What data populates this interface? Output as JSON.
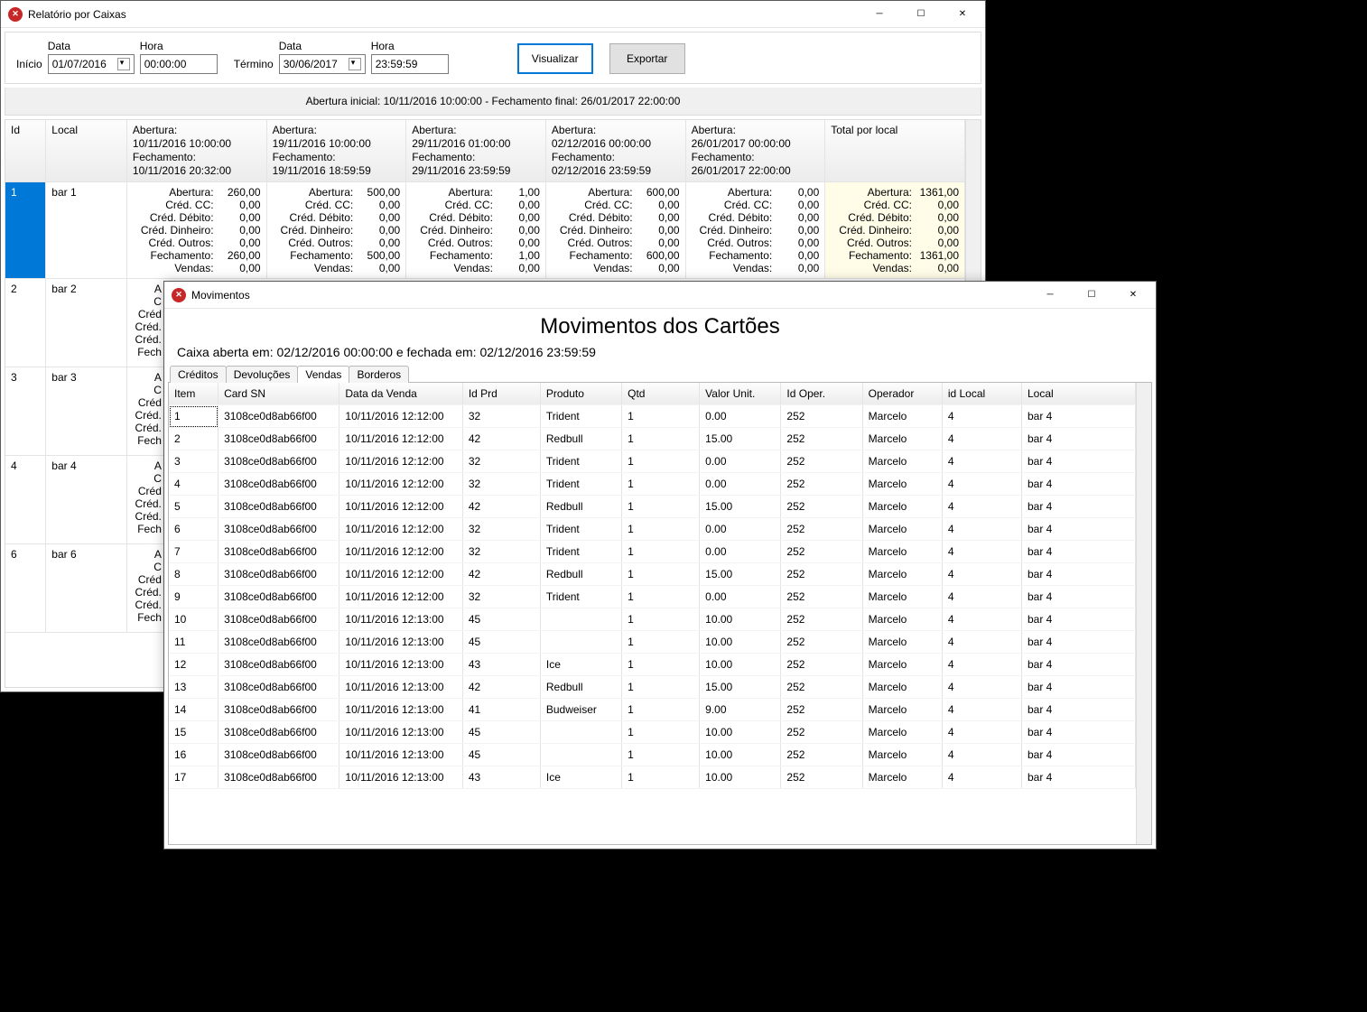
{
  "main": {
    "title": "Relatório por Caixas",
    "toolbar": {
      "inicio_label": "Início",
      "termino_label": "Término",
      "data_label": "Data",
      "hora_label": "Hora",
      "inicio_data": "01/07/2016",
      "inicio_hora": "00:00:00",
      "termino_data": "30/06/2017",
      "termino_hora": "23:59:59",
      "visualizar": "Visualizar",
      "exportar": "Exportar"
    },
    "summary": "Abertura inicial: 10/11/2016 10:00:00 - Fechamento final:  26/01/2017 22:00:00",
    "headers": {
      "id": "Id",
      "local": "Local",
      "total": "Total por local"
    },
    "period_headers": [
      "Abertura:\n10/11/2016 10:00:00\nFechamento:\n10/11/2016 20:32:00",
      "Abertura:\n19/11/2016 10:00:00\nFechamento:\n19/11/2016 18:59:59",
      "Abertura:\n29/11/2016 01:00:00\nFechamento:\n29/11/2016 23:59:59",
      "Abertura:\n02/12/2016 00:00:00\nFechamento:\n02/12/2016 23:59:59",
      "Abertura:\n26/01/2017 00:00:00\nFechamento:\n26/01/2017 22:00:00"
    ],
    "kv_labels": [
      "Abertura:",
      "Créd. CC:",
      "Créd. Débito:",
      "Créd. Dinheiro:",
      "Créd. Outros:",
      "Fechamento:",
      "Vendas:"
    ],
    "rows": [
      {
        "id": "1",
        "local": "bar 1",
        "selected": true,
        "periods": [
          [
            "260,00",
            "0,00",
            "0,00",
            "0,00",
            "0,00",
            "260,00",
            "0,00"
          ],
          [
            "500,00",
            "0,00",
            "0,00",
            "0,00",
            "0,00",
            "500,00",
            "0,00"
          ],
          [
            "1,00",
            "0,00",
            "0,00",
            "0,00",
            "0,00",
            "1,00",
            "0,00"
          ],
          [
            "600,00",
            "0,00",
            "0,00",
            "0,00",
            "0,00",
            "600,00",
            "0,00"
          ],
          [
            "0,00",
            "0,00",
            "0,00",
            "0,00",
            "0,00",
            "0,00",
            "0,00"
          ]
        ],
        "total": [
          "1361,00",
          "0,00",
          "0,00",
          "0,00",
          "0,00",
          "1361,00",
          "0,00"
        ]
      },
      {
        "id": "2",
        "local": "bar 2"
      },
      {
        "id": "3",
        "local": "bar 3"
      },
      {
        "id": "4",
        "local": "bar 4"
      },
      {
        "id": "6",
        "local": "bar 6"
      }
    ],
    "truncated_labels": [
      "A",
      "C",
      "Créd",
      "Créd.",
      "Créd.",
      "Fech"
    ]
  },
  "mov": {
    "title": "Movimentos",
    "big_title": "Movimentos dos Cartões",
    "subtitle": "Caixa aberta em: 02/12/2016 00:00:00 e fechada em: 02/12/2016 23:59:59",
    "tabs": [
      "Créditos",
      "Devoluções",
      "Vendas",
      "Borderos"
    ],
    "active_tab": 2,
    "columns": [
      "Item",
      "Card SN",
      "Data da Venda",
      "Id Prd",
      "Produto",
      "Qtd",
      "Valor Unit.",
      "Id Oper.",
      "Operador",
      "id Local",
      "Local"
    ],
    "rows": [
      [
        "1",
        "3108ce0d8ab66f00",
        "10/11/2016 12:12:00",
        "32",
        "Trident",
        "1",
        "0.00",
        "252",
        "Marcelo",
        "4",
        "bar 4"
      ],
      [
        "2",
        "3108ce0d8ab66f00",
        "10/11/2016 12:12:00",
        "42",
        "Redbull",
        "1",
        "15.00",
        "252",
        "Marcelo",
        "4",
        "bar 4"
      ],
      [
        "3",
        "3108ce0d8ab66f00",
        "10/11/2016 12:12:00",
        "32",
        "Trident",
        "1",
        "0.00",
        "252",
        "Marcelo",
        "4",
        "bar 4"
      ],
      [
        "4",
        "3108ce0d8ab66f00",
        "10/11/2016 12:12:00",
        "32",
        "Trident",
        "1",
        "0.00",
        "252",
        "Marcelo",
        "4",
        "bar 4"
      ],
      [
        "5",
        "3108ce0d8ab66f00",
        "10/11/2016 12:12:00",
        "42",
        "Redbull",
        "1",
        "15.00",
        "252",
        "Marcelo",
        "4",
        "bar 4"
      ],
      [
        "6",
        "3108ce0d8ab66f00",
        "10/11/2016 12:12:00",
        "32",
        "Trident",
        "1",
        "0.00",
        "252",
        "Marcelo",
        "4",
        "bar 4"
      ],
      [
        "7",
        "3108ce0d8ab66f00",
        "10/11/2016 12:12:00",
        "32",
        "Trident",
        "1",
        "0.00",
        "252",
        "Marcelo",
        "4",
        "bar 4"
      ],
      [
        "8",
        "3108ce0d8ab66f00",
        "10/11/2016 12:12:00",
        "42",
        "Redbull",
        "1",
        "15.00",
        "252",
        "Marcelo",
        "4",
        "bar 4"
      ],
      [
        "9",
        "3108ce0d8ab66f00",
        "10/11/2016 12:12:00",
        "32",
        "Trident",
        "1",
        "0.00",
        "252",
        "Marcelo",
        "4",
        "bar 4"
      ],
      [
        "10",
        "3108ce0d8ab66f00",
        "10/11/2016 12:13:00",
        "45",
        "",
        "1",
        "10.00",
        "252",
        "Marcelo",
        "4",
        "bar 4"
      ],
      [
        "11",
        "3108ce0d8ab66f00",
        "10/11/2016 12:13:00",
        "45",
        "",
        "1",
        "10.00",
        "252",
        "Marcelo",
        "4",
        "bar 4"
      ],
      [
        "12",
        "3108ce0d8ab66f00",
        "10/11/2016 12:13:00",
        "43",
        "Ice",
        "1",
        "10.00",
        "252",
        "Marcelo",
        "4",
        "bar 4"
      ],
      [
        "13",
        "3108ce0d8ab66f00",
        "10/11/2016 12:13:00",
        "42",
        "Redbull",
        "1",
        "15.00",
        "252",
        "Marcelo",
        "4",
        "bar 4"
      ],
      [
        "14",
        "3108ce0d8ab66f00",
        "10/11/2016 12:13:00",
        "41",
        "Budweiser",
        "1",
        "9.00",
        "252",
        "Marcelo",
        "4",
        "bar 4"
      ],
      [
        "15",
        "3108ce0d8ab66f00",
        "10/11/2016 12:13:00",
        "45",
        "",
        "1",
        "10.00",
        "252",
        "Marcelo",
        "4",
        "bar 4"
      ],
      [
        "16",
        "3108ce0d8ab66f00",
        "10/11/2016 12:13:00",
        "45",
        "",
        "1",
        "10.00",
        "252",
        "Marcelo",
        "4",
        "bar 4"
      ],
      [
        "17",
        "3108ce0d8ab66f00",
        "10/11/2016 12:13:00",
        "43",
        "Ice",
        "1",
        "10.00",
        "252",
        "Marcelo",
        "4",
        "bar 4"
      ]
    ]
  }
}
